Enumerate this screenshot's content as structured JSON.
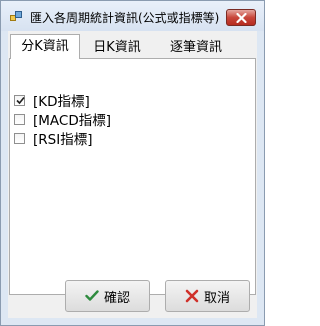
{
  "window": {
    "title": "匯入各周期統計資訊(公式或指標等)"
  },
  "tabs": [
    {
      "label": "分K資訊",
      "active": true
    },
    {
      "label": "日K資訊",
      "active": false
    },
    {
      "label": "逐筆資訊",
      "active": false
    }
  ],
  "options": [
    {
      "label": "[KD指標]",
      "checked": true
    },
    {
      "label": "[MACD指標]",
      "checked": false
    },
    {
      "label": "[RSI指標]",
      "checked": false
    }
  ],
  "buttons": {
    "ok_label": "確認",
    "cancel_label": "取消"
  },
  "colors": {
    "close_button": "#c8463b",
    "ok_icon": "#2e8b3e",
    "cancel_icon": "#d0302a"
  },
  "icons": {
    "app": "app-window-icon",
    "close": "close-icon",
    "ok": "checkmark-icon",
    "cancel": "x-icon"
  }
}
